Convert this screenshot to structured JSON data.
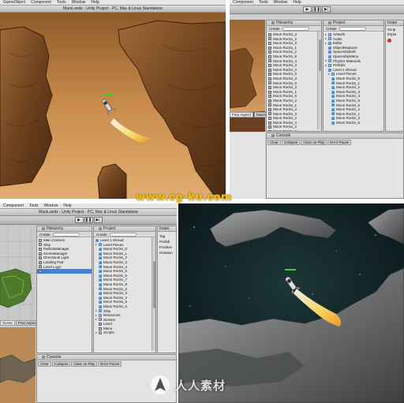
{
  "menu": {
    "q1": [
      "GameObject",
      "Component",
      "Tools",
      "Window",
      "Help"
    ],
    "q2": [
      "Component",
      "Tools",
      "Window",
      "Help"
    ],
    "q3": [
      "Component",
      "Tools",
      "Window",
      "Help"
    ]
  },
  "window": {
    "title_q1": "MarsLandz - Unity Project - PC, Mac & Linux Standalone",
    "title_q3": "MarsLandz - Unity Project - PC, Mac & Linux Standalone"
  },
  "toolbar": {
    "play_label": "▶",
    "pause_label": "❚❚",
    "step_label": "▶|"
  },
  "q2": {
    "hierarchy": {
      "title": "Hierarchy",
      "create_label": "Create",
      "items": [
        "Moon Rocks_3",
        "Moon Rocks_2",
        "Moon Rocks_3",
        "Moon Rocks_1",
        "Moon Rocks_2",
        "Moon Rocks_5",
        "Moon Rocks_4",
        "Moon Rocks_3",
        "Moon Rocks_2",
        "Moon Rocks_5",
        "Moon Rocks_3",
        "Moon Rocks_6",
        "Moon Rocks_3",
        "Moon Rocks_1",
        "Moon Rocks_5",
        "Moon Rocks_2",
        "Moon Rocks_1",
        "Moon Rocks_4",
        "Moon Rocks_3",
        "Moon Rocks_2",
        "Moon Rocks_4",
        "Moon Rocks_2",
        "Moon Rocks_6",
        "Moon Rocks_3",
        "Moon Rocks_3",
        "Moon Rocks_1",
        "Moon Rocks_2"
      ]
    },
    "project": {
      "title": "Project",
      "create_label": "Create",
      "items": [
        {
          "label": "Artwork",
          "icon": "folder",
          "indent": 0
        },
        {
          "label": "Audio",
          "icon": "folder",
          "indent": 0
        },
        {
          "label": "Editor",
          "icon": "folder",
          "indent": 0
        },
        {
          "label": "ObjectReplacer",
          "icon": "prefab",
          "indent": 1
        },
        {
          "label": "SpaceshipEdit",
          "icon": "prefab",
          "indent": 1
        },
        {
          "label": "SpaceshipMenu",
          "icon": "prefab",
          "indent": 1
        },
        {
          "label": "Physics Materials",
          "icon": "folder",
          "indent": 0
        },
        {
          "label": "Prefabs",
          "icon": "folder",
          "indent": 0
        },
        {
          "label": "Level 1 shroud",
          "icon": "prefab",
          "indent": 1
        },
        {
          "label": "Level Pieces",
          "icon": "folder",
          "indent": 1
        },
        {
          "label": "Moon Rocks_0",
          "icon": "mesh",
          "indent": 2
        },
        {
          "label": "Moon Rocks_1",
          "icon": "mesh",
          "indent": 2
        },
        {
          "label": "Moon Rocks_2",
          "icon": "mesh",
          "indent": 2
        },
        {
          "label": "Moon Rocks_3",
          "icon": "mesh",
          "indent": 2
        },
        {
          "label": "Moon Rocks_4",
          "icon": "mesh",
          "indent": 2
        },
        {
          "label": "Moon Rocks_5",
          "icon": "mesh",
          "indent": 2
        },
        {
          "label": "Moon Rocks_6",
          "icon": "mesh",
          "indent": 2
        },
        {
          "label": "Moon Rocks_2",
          "icon": "mesh",
          "indent": 2
        },
        {
          "label": "Moon Rocks_1",
          "icon": "mesh",
          "indent": 2
        },
        {
          "label": "Moon Rocks_3",
          "icon": "mesh",
          "indent": 2
        },
        {
          "label": "Moon Rocks_5",
          "icon": "mesh",
          "indent": 2
        }
      ]
    },
    "inspector": {
      "title": "Inspe",
      "items": [
        "Scrip",
        "Explo"
      ]
    },
    "scene_tabs": [
      "Free Aspect",
      "Maximize on Play",
      "Stats",
      "Gizmos"
    ],
    "console": {
      "title": "Console",
      "buttons": [
        "Clear",
        "Collapse",
        "Clear on Play",
        "Error Pause"
      ]
    }
  },
  "q3": {
    "hierarchy": {
      "title": "Hierarchy",
      "create_label": "Create",
      "items": [
        "Main Camera",
        "Ship",
        "ParticleManager",
        "SceneManager",
        "Directional Light",
        "Landing Pad",
        "Level Logic",
        ""
      ]
    },
    "project": {
      "title": "Project",
      "create_label": "Create",
      "items": [
        {
          "label": "Level 1 shroud",
          "icon": "prefab",
          "indent": 0
        },
        {
          "label": "Level Pieces",
          "icon": "folder",
          "indent": 0
        },
        {
          "label": "Moon Rocks_0",
          "icon": "mesh",
          "indent": 1
        },
        {
          "label": "Moon Rocks_1",
          "icon": "mesh",
          "indent": 1
        },
        {
          "label": "Moon Rocks_2",
          "icon": "mesh",
          "indent": 1
        },
        {
          "label": "Moon Rocks_3",
          "icon": "mesh",
          "indent": 1
        },
        {
          "label": "Moon Rocks_4",
          "icon": "mesh",
          "indent": 1
        },
        {
          "label": "Moon Rocks_5",
          "icon": "mesh",
          "indent": 1
        },
        {
          "label": "Moon Rocks_6",
          "icon": "mesh",
          "indent": 1
        },
        {
          "label": "Moon Rocks_7",
          "icon": "mesh",
          "indent": 1
        },
        {
          "label": "Moon Rocks_8",
          "icon": "mesh",
          "indent": 1
        },
        {
          "label": "Moon Rocks_2",
          "icon": "mesh",
          "indent": 1
        },
        {
          "label": "Moon Rocks_3",
          "icon": "mesh",
          "indent": 1
        },
        {
          "label": "Moon Rocks_4",
          "icon": "mesh",
          "indent": 1
        },
        {
          "label": "Moon Rocks_5",
          "icon": "mesh",
          "indent": 1
        },
        {
          "label": "Moon Rocks_6",
          "icon": "mesh",
          "indent": 1
        },
        {
          "label": "Ship",
          "icon": "folder",
          "indent": 0
        },
        {
          "label": "Resources",
          "icon": "folder",
          "indent": 0
        },
        {
          "label": "Scenes",
          "icon": "folder",
          "indent": 0
        },
        {
          "label": "Level",
          "icon": "cube",
          "indent": 1
        },
        {
          "label": "Menu",
          "icon": "cube",
          "indent": 1
        },
        {
          "label": "Scripts",
          "icon": "folder",
          "indent": 0
        }
      ]
    },
    "inspector": {
      "title": "Inspe",
      "items": [
        "Tag",
        "Prefab",
        "Position",
        "Rotation"
      ]
    },
    "scene_tabs": [
      "Scene",
      "Free Aspect",
      "Stats",
      "Gizmos"
    ],
    "console": {
      "title": "Console",
      "buttons": [
        "Clear",
        "Collapse",
        "Clear on Play",
        "Error Pause"
      ]
    }
  },
  "watermark": {
    "text": "www.cg-ku.com"
  },
  "brand": {
    "text": "人人素材"
  },
  "colors": {
    "mars_sky_top": "#9a6532",
    "mars_sky_bottom": "#e0a86a",
    "rock_brown": "#7a4a22",
    "space_bg": "#0d1a1c",
    "moon_rock": "#77797a",
    "selection_blue": "#3d80df",
    "thruster_flame": "#f2d25c"
  }
}
